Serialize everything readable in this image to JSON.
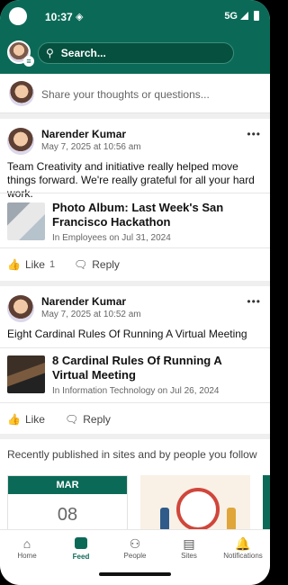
{
  "statusbar": {
    "time": "10:37",
    "network": "5G"
  },
  "search": {
    "placeholder": "Search..."
  },
  "composer": {
    "placeholder": "Share your thoughts or questions..."
  },
  "posts": [
    {
      "author": "Narender Kumar",
      "time": "May 7, 2025 at 10:56 am",
      "text": "Team Creativity and initiative really helped move things forward. We're really grateful for all your hard work.",
      "link_title": "Photo Album: Last Week's San Francisco Hackathon",
      "link_meta": "In Employees on Jul 31, 2024",
      "like_label": "Like",
      "like_count": "1",
      "reply_label": "Reply"
    },
    {
      "author": "Narender Kumar",
      "time": "May 7, 2025 at 10:52 am",
      "text": "Eight Cardinal Rules Of Running A Virtual Meeting",
      "link_title": "8 Cardinal Rules Of Running A Virtual Meeting",
      "link_meta": "In Information Technology on Jul 26, 2024",
      "like_label": "Like",
      "reply_label": "Reply"
    }
  ],
  "recent": {
    "title": "Recently published in sites and by people you follow",
    "event_month": "MAR",
    "event_day": "08"
  },
  "nav": [
    {
      "label": "Home",
      "icon": "home-icon"
    },
    {
      "label": "Feed",
      "icon": "feed-icon"
    },
    {
      "label": "People",
      "icon": "people-icon"
    },
    {
      "label": "Sites",
      "icon": "sites-icon"
    },
    {
      "label": "Notifications",
      "icon": "bell-icon"
    }
  ],
  "colors": {
    "brand": "#0b6a57"
  }
}
